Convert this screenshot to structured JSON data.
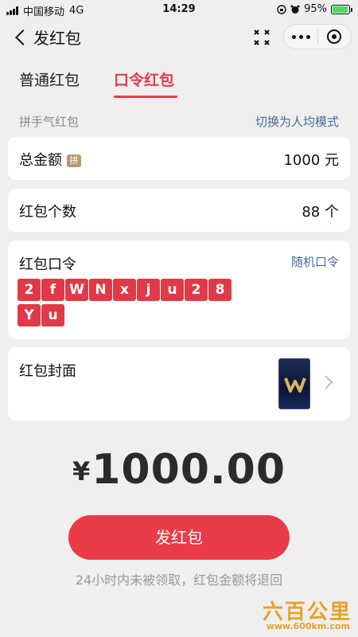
{
  "status_bar": {
    "carrier": "中国移动",
    "network": "4G",
    "time": "14:29",
    "battery": "95%",
    "battery_level": 0.95
  },
  "nav": {
    "title": "发红包"
  },
  "tabs": [
    {
      "label": "普通红包",
      "active": false
    },
    {
      "label": "口令红包",
      "active": true
    }
  ],
  "mode": {
    "left": "拼手气红包",
    "switch": "切换为人均模式"
  },
  "total": {
    "label": "总金额",
    "badge": "拼",
    "value": "1000 元"
  },
  "count": {
    "label": "红包个数",
    "value": "88 个"
  },
  "password": {
    "label": "红包口令",
    "random": "随机口令",
    "chars": [
      "2",
      "f",
      "W",
      "N",
      "x",
      "j",
      "u",
      "2",
      "8",
      "Y",
      "u"
    ]
  },
  "cover": {
    "label": "红包封面"
  },
  "amount": {
    "currency": "¥",
    "value": "1000.00"
  },
  "send_button": "发红包",
  "notice": "24小时内未被领取，红包金额将退回",
  "watermark": {
    "logo": "六百公里",
    "url": "www.600km.com"
  },
  "colors": {
    "accent": "#e23c4c",
    "button": "#ea3b49",
    "link": "#4a6a9a",
    "badge": "#b59a6c"
  }
}
